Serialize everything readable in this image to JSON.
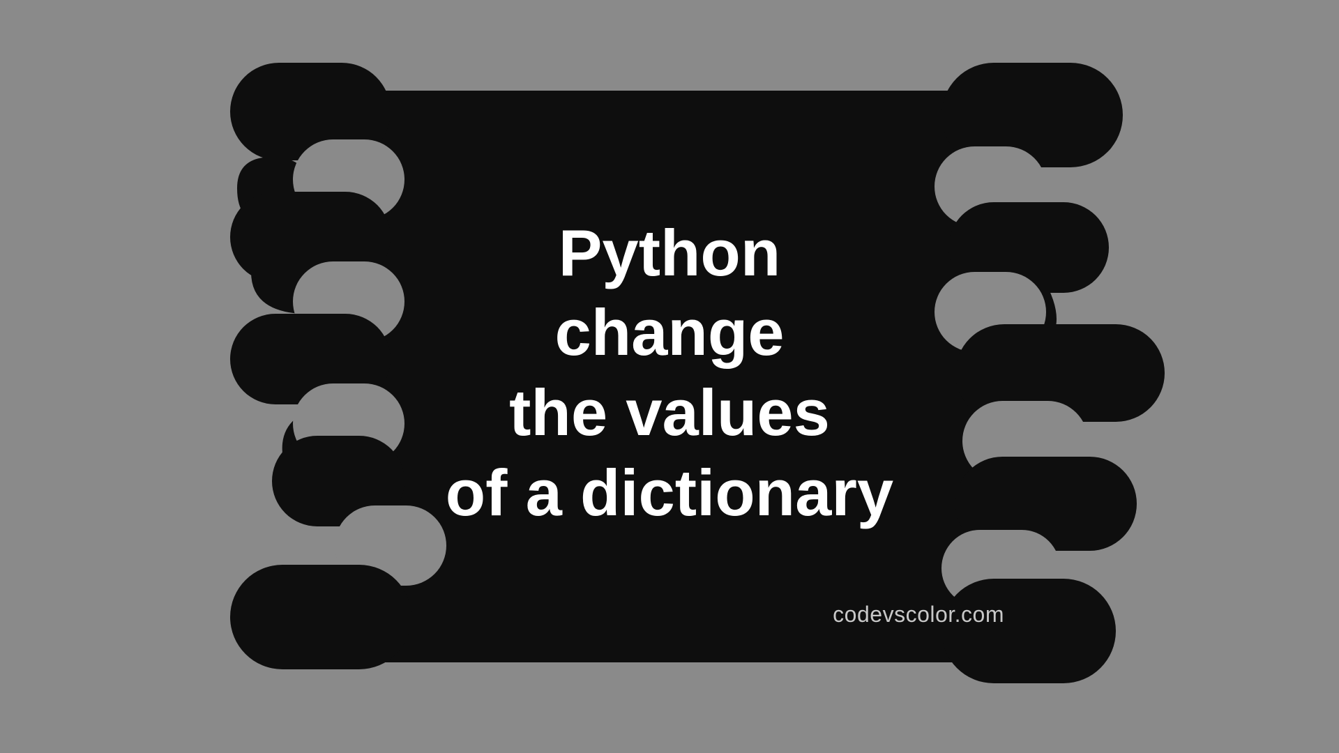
{
  "title_lines": {
    "l1": "Python",
    "l2": "change",
    "l3": "the values",
    "l4": "of a dictionary"
  },
  "credit": "codevscolor.com",
  "colors": {
    "bg": "#8a8a8a",
    "blob": "#0e0e0e",
    "text": "#ffffff",
    "credit": "#c8c8c8"
  }
}
